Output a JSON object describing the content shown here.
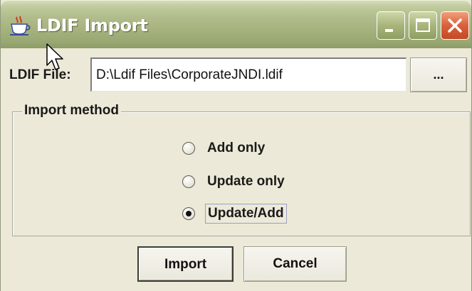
{
  "window": {
    "title": "LDIF Import",
    "app_icon": "java-coffee-cup-icon",
    "controls": {
      "minimize": "minimize-icon",
      "maximize": "maximize-icon",
      "close": "close-icon"
    }
  },
  "file_row": {
    "label": "LDIF File:",
    "value": "D:\\Ldif Files\\CorporateJNDI.ldif",
    "browse_label": "..."
  },
  "import_method": {
    "legend": "Import method",
    "options": [
      {
        "label": "Add only",
        "selected": false
      },
      {
        "label": "Update only",
        "selected": false
      },
      {
        "label": "Update/Add",
        "selected": true
      }
    ]
  },
  "buttons": {
    "import_label": "Import",
    "cancel_label": "Cancel"
  },
  "colors": {
    "title_bar": "#a6b37e",
    "close_button": "#d9603a",
    "dialog_background": "#ece9d8"
  }
}
